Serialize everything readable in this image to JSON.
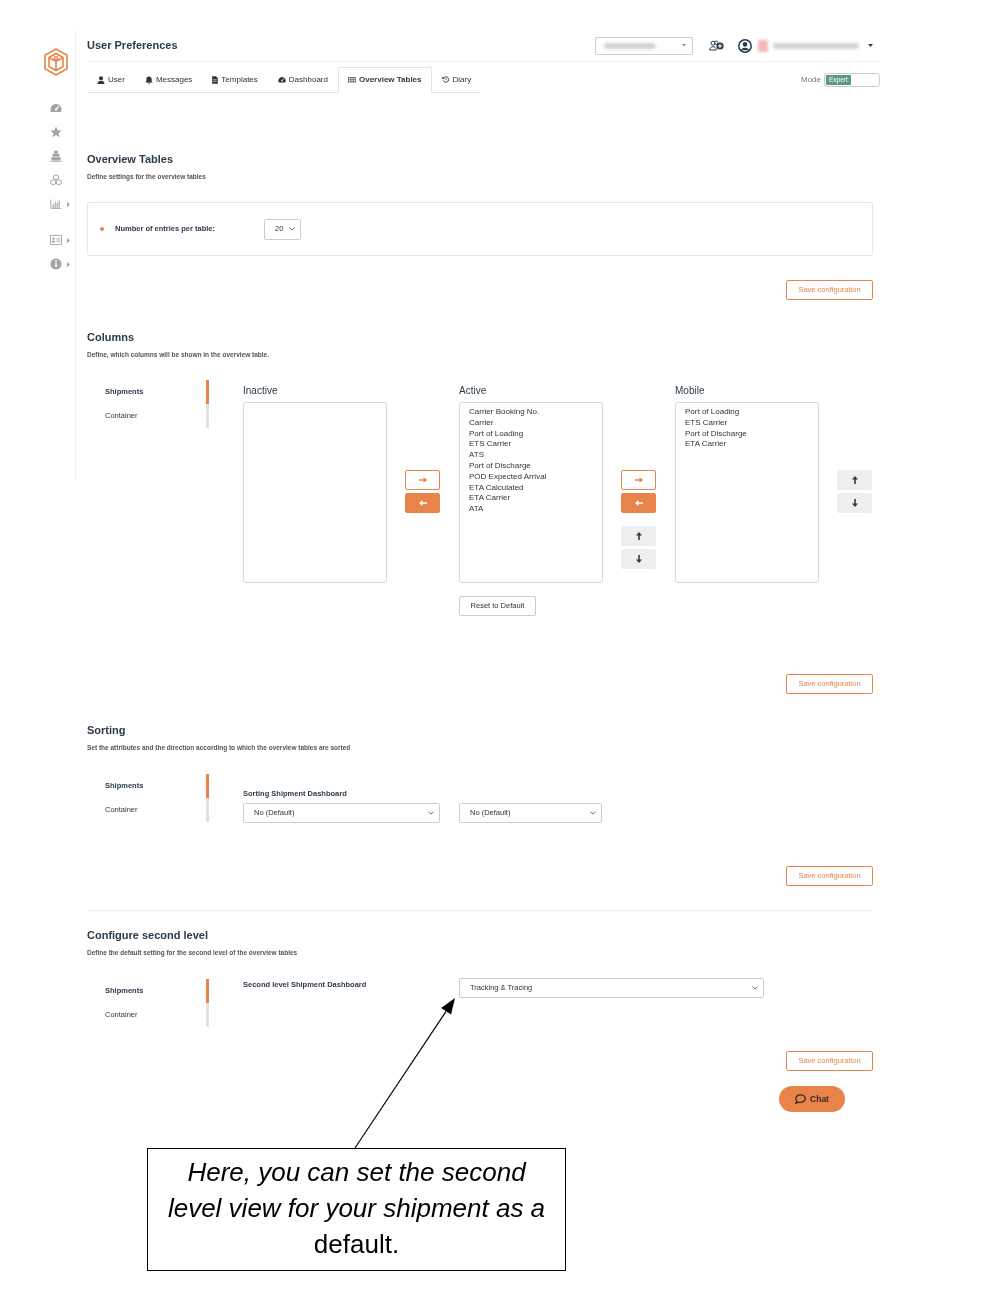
{
  "sidebar": {
    "groups": [
      [
        {
          "has_submenu": false
        },
        {
          "has_submenu": false
        },
        {
          "has_submenu": false
        },
        {
          "has_submenu": false
        },
        {
          "has_submenu": true
        }
      ],
      [
        {
          "has_submenu": true
        },
        {
          "has_submenu": true
        }
      ]
    ]
  },
  "header": {
    "title": "User Preferences"
  },
  "tabs": [
    {
      "label": "User",
      "selected": false
    },
    {
      "label": "Messages",
      "selected": false
    },
    {
      "label": "Templates",
      "selected": false
    },
    {
      "label": "Dashboard",
      "selected": false
    },
    {
      "label": "Overview Tables",
      "selected": true
    },
    {
      "label": "Diary",
      "selected": false
    }
  ],
  "mode_switch": {
    "label": "Mode",
    "value": "Expert",
    "on": true
  },
  "overview": {
    "title": "Overview Tables",
    "description": "Define settings for the overview tables",
    "fields": [
      {
        "label": "Number of entries per table:",
        "value": "20"
      }
    ],
    "save_button": "Save configuration"
  },
  "columns": {
    "title": "Columns",
    "description": "Define, which columns will be shown in the overview table.",
    "entity_tabs": [
      {
        "label": "Shipments",
        "selected": true
      },
      {
        "label": "Container",
        "selected": false
      }
    ],
    "lists": [
      {
        "title": "Inactive"
      },
      {
        "title": "Active",
        "items": [
          "Carrier Booking No.",
          "Carrier",
          "Port of Loading",
          "ETS Carrier",
          "ATS",
          "Port of Discharge",
          "POD Expected Arrival",
          "ETA Calculated",
          "ETA Carrier",
          "ATA"
        ],
        "reset_button": "Reset to Default"
      },
      {
        "title": "Mobile",
        "items": [
          "Port of Loading",
          "ETS Carrier",
          "Port of Discharge",
          "ETA Carrier"
        ]
      }
    ],
    "save_button": "Save configuration"
  },
  "sorting": {
    "title": "Sorting",
    "description": "Set the attributes and the direction according to which the overview tables are sorted",
    "entity_tabs": [
      {
        "label": "Shipments",
        "selected": true
      },
      {
        "label": "Container",
        "selected": false
      }
    ],
    "field_label": "Sorting Shipment Dashboard",
    "selects": [
      "No (Default)",
      "No (Default)"
    ],
    "save_button": "Save configuration"
  },
  "second_level": {
    "title": "Configure second level",
    "description": "Define the default setting for the second level of the overview tables",
    "entity_tabs": [
      {
        "label": "Shipments",
        "selected": true
      },
      {
        "label": "Container",
        "selected": false
      }
    ],
    "field_label": "Second level Shipment Dashboard",
    "select": "Tracking & Tracing",
    "save_button": "Save configuration"
  },
  "chat_button": {
    "label": "Chat"
  },
  "callout": {
    "text": "*Here, you can set the second level view for your shipment as a* default."
  }
}
